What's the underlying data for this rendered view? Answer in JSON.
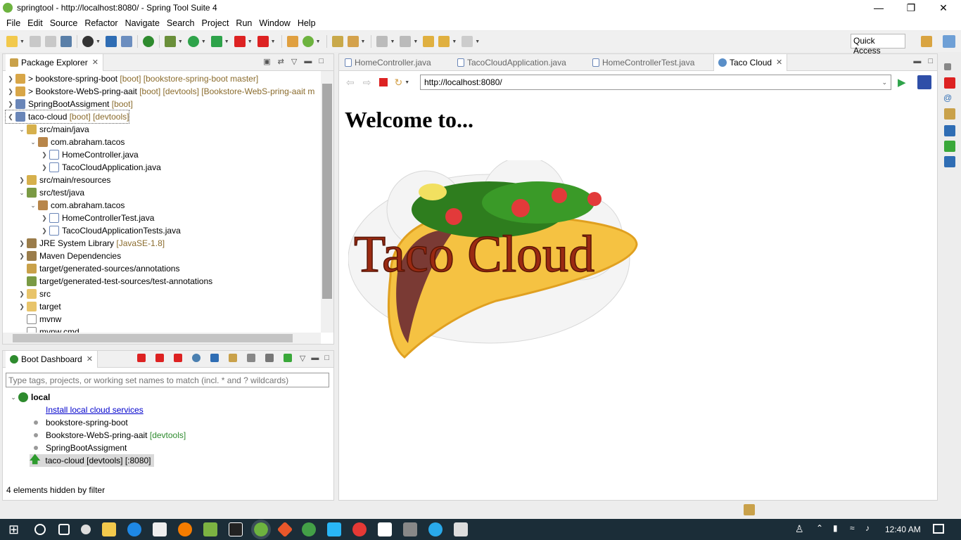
{
  "window": {
    "title": "springtool - http://localhost:8080/ - Spring Tool Suite 4"
  },
  "menu": [
    "File",
    "Edit",
    "Source",
    "Refactor",
    "Navigate",
    "Search",
    "Project",
    "Run",
    "Window",
    "Help"
  ],
  "quick_access": "Quick Access",
  "package_explorer": {
    "title": "Package Explorer",
    "items": [
      {
        "label": "> bookstore-spring-boot",
        "deco": "[boot] [bookstore-spring-boot master]"
      },
      {
        "label": "> Bookstore-WebS-pring-aait",
        "deco": "[boot] [devtools] [Bookstore-WebS-pring-aait m"
      },
      {
        "label": "SpringBootAssigment",
        "deco": "[boot]"
      },
      {
        "label": "taco-cloud",
        "deco": "[boot] [devtools]"
      },
      {
        "label": "src/main/java",
        "deco": ""
      },
      {
        "label": "com.abraham.tacos",
        "deco": ""
      },
      {
        "label": "HomeController.java",
        "deco": ""
      },
      {
        "label": "TacoCloudApplication.java",
        "deco": ""
      },
      {
        "label": "src/main/resources",
        "deco": ""
      },
      {
        "label": "src/test/java",
        "deco": ""
      },
      {
        "label": "com.abraham.tacos",
        "deco": ""
      },
      {
        "label": "HomeControllerTest.java",
        "deco": ""
      },
      {
        "label": "TacoCloudApplicationTests.java",
        "deco": ""
      },
      {
        "label": "JRE System Library",
        "deco": "[JavaSE-1.8]"
      },
      {
        "label": "Maven Dependencies",
        "deco": ""
      },
      {
        "label": "target/generated-sources/annotations",
        "deco": ""
      },
      {
        "label": "target/generated-test-sources/test-annotations",
        "deco": ""
      },
      {
        "label": "src",
        "deco": ""
      },
      {
        "label": "target",
        "deco": ""
      },
      {
        "label": "mvnw",
        "deco": ""
      },
      {
        "label": "mvnw.cmd",
        "deco": ""
      }
    ]
  },
  "boot_dashboard": {
    "title": "Boot Dashboard",
    "filter_placeholder": "Type tags, projects, or working set names to match (incl. * and ? wildcards)",
    "local": "local",
    "install_link": "Install local cloud services",
    "apps": [
      {
        "name": "bookstore-spring-boot",
        "tag": ""
      },
      {
        "name": "Bookstore-WebS-pring-aait",
        "tag": "[devtools]"
      },
      {
        "name": "SpringBootAssigment",
        "tag": ""
      },
      {
        "name": "taco-cloud [devtools] [:8080]",
        "tag": ""
      }
    ],
    "status": "4 elements hidden by filter"
  },
  "editor_tabs": [
    {
      "label": "HomeController.java"
    },
    {
      "label": "TacoCloudApplication.java"
    },
    {
      "label": "HomeControllerTest.java"
    },
    {
      "label": "Taco Cloud"
    }
  ],
  "browser": {
    "url": "http://localhost:8080/",
    "heading": "Welcome to...",
    "logo_text": "Taco Cloud"
  },
  "taskbar": {
    "time": "12:40 AM"
  },
  "colors": {
    "accent": "#6db33f",
    "link": "#0000cc",
    "deco": "#8a6b2c"
  }
}
